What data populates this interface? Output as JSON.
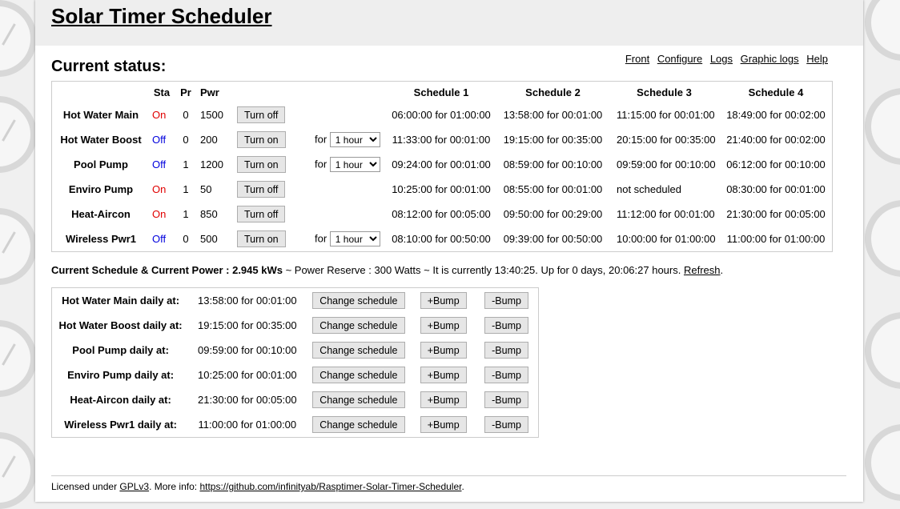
{
  "title": "Solar Timer Scheduler",
  "status_heading": "Current status:",
  "nav": [
    "Front",
    "Configure",
    "Logs",
    "Graphic logs",
    "Help"
  ],
  "status_headers": {
    "sta": "Sta",
    "pr": "Pr",
    "pwr": "Pwr",
    "s1": "Schedule 1",
    "s2": "Schedule 2",
    "s3": "Schedule 3",
    "s4": "Schedule 4"
  },
  "devices": [
    {
      "name": "Hot Water Main",
      "state": "On",
      "pr": "0",
      "pwr": "1500",
      "button": "Turn off",
      "for_label": "",
      "duration": "",
      "s1": "06:00:00 for 01:00:00",
      "s2": "13:58:00 for 00:01:00",
      "s3": "11:15:00 for 00:01:00",
      "s4": "18:49:00 for 00:02:00"
    },
    {
      "name": "Hot Water Boost",
      "state": "Off",
      "pr": "0",
      "pwr": "200",
      "button": "Turn on",
      "for_label": "for",
      "duration": "1 hour",
      "s1": "11:33:00 for 00:01:00",
      "s2": "19:15:00 for 00:35:00",
      "s3": "20:15:00 for 00:35:00",
      "s4": "21:40:00 for 00:02:00"
    },
    {
      "name": "Pool Pump",
      "state": "Off",
      "pr": "1",
      "pwr": "1200",
      "button": "Turn on",
      "for_label": "for",
      "duration": "1 hour",
      "s1": "09:24:00 for 00:01:00",
      "s2": "08:59:00 for 00:10:00",
      "s3": "09:59:00 for 00:10:00",
      "s4": "06:12:00 for 00:10:00"
    },
    {
      "name": "Enviro Pump",
      "state": "On",
      "pr": "1",
      "pwr": "50",
      "button": "Turn off",
      "for_label": "",
      "duration": "",
      "s1": "10:25:00 for 00:01:00",
      "s2": "08:55:00 for 00:01:00",
      "s3": "not scheduled",
      "s4": "08:30:00 for 00:01:00"
    },
    {
      "name": "Heat-Aircon",
      "state": "On",
      "pr": "1",
      "pwr": "850",
      "button": "Turn off",
      "for_label": "",
      "duration": "",
      "s1": "08:12:00 for 00:05:00",
      "s2": "09:50:00 for 00:29:00",
      "s3": "11:12:00 for 00:01:00",
      "s4": "21:30:00 for 00:05:00"
    },
    {
      "name": "Wireless Pwr1",
      "state": "Off",
      "pr": "0",
      "pwr": "500",
      "button": "Turn on",
      "for_label": "for",
      "duration": "1 hour",
      "s1": "08:10:00 for 00:50:00",
      "s2": "09:39:00 for 00:50:00",
      "s3": "10:00:00 for 01:00:00",
      "s4": "11:00:00 for 01:00:00"
    }
  ],
  "summary": {
    "label": "Current Schedule & Current Power : 2.945 kWs",
    "text": " ~ Power Reserve : 300 Watts ~ It is currently 13:40:25. Up for 0 days, 20:06:27 hours. ",
    "refresh": "Refresh",
    "end": "."
  },
  "daily": [
    {
      "label": "Hot Water Main daily at:",
      "time": "13:58:00 for 00:01:00"
    },
    {
      "label": "Hot Water Boost daily at:",
      "time": "19:15:00 for 00:35:00"
    },
    {
      "label": "Pool Pump daily at:",
      "time": "09:59:00 for 00:10:00"
    },
    {
      "label": "Enviro Pump daily at:",
      "time": "10:25:00 for 00:01:00"
    },
    {
      "label": "Heat-Aircon daily at:",
      "time": "21:30:00 for 00:05:00"
    },
    {
      "label": "Wireless Pwr1 daily at:",
      "time": "11:00:00 for 01:00:00"
    }
  ],
  "daily_buttons": {
    "change": "Change schedule",
    "bump_up": "+Bump",
    "bump_down": "-Bump"
  },
  "footer": {
    "prefix": "Licensed under ",
    "license": "GPLv3",
    "middle": ". More info: ",
    "url": "https://github.com/infinityab/Rasptimer-Solar-Timer-Scheduler",
    "end": "."
  },
  "colors": {
    "on": "#e00000",
    "off": "#0000dd",
    "header_bg": "#eeeeee"
  }
}
